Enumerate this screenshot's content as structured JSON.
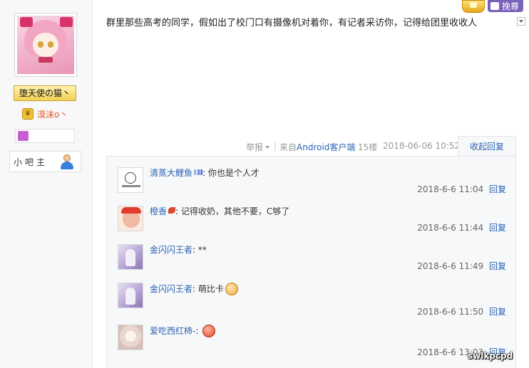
{
  "author": {
    "name": "堕天使の猫丶",
    "vip_label": "漠沫o丶",
    "role": "小吧主",
    "icons": {
      "vip": "vip-crown-icon",
      "badge": "member-badge-icon",
      "role": "user-icon"
    }
  },
  "top_bar": {
    "honor_label": "挽尊"
  },
  "post": {
    "text": "群里那些高考的同学，假如出了校门口有摄像机对着你，有记者采访你，记得给团里收收人",
    "report_label": "举报",
    "separator": "|",
    "from_prefix": "来自",
    "from_client": "Android客户端",
    "floor": "15楼",
    "time": "2018-06-06 10:52",
    "fold_label": "收起回复"
  },
  "replies": [
    {
      "user": "清蒸大鲤鱼",
      "text": "你也是个人才",
      "time": "2018-6-6 11:04",
      "reply_label": "回复"
    },
    {
      "user": "橙香",
      "text": "记得收奶，其他不要，C够了",
      "time": "2018-6-6 11:44",
      "reply_label": "回复"
    },
    {
      "user": "金闪闪王者",
      "text": "**",
      "time": "2018-6-6 11:49",
      "reply_label": "回复"
    },
    {
      "user": "金闪闪王者",
      "text": "萌比卡",
      "time": "2018-6-6 11:50",
      "reply_label": "回复"
    },
    {
      "user": "爱吃西红柿-",
      "text": "",
      "time": "2018-6-6 13:03",
      "reply_label": "回复"
    }
  ],
  "watermark": "swlkpcpd",
  "colors": {
    "link": "#2d64b3",
    "name_badge": "#f2cf55",
    "vip_text": "#e25c2b",
    "honor": "#7a63b8"
  }
}
